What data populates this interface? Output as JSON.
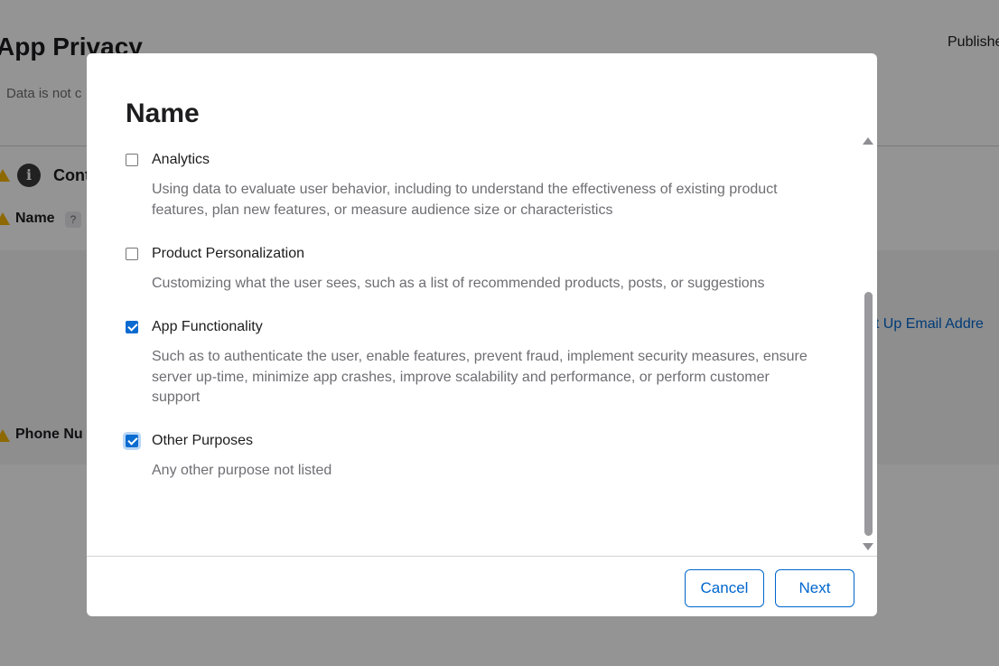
{
  "background": {
    "title": "App Privacy",
    "status_text": "Data is not c",
    "publish_text": "Publishe",
    "section_label": "Cont",
    "row_name": "Name",
    "help_glyph": "?",
    "setup_link": "et Up Email Addre",
    "row_phone": "Phone Nu"
  },
  "modal": {
    "title": "Name",
    "options": [
      {
        "label": "Analytics",
        "description": "Using data to evaluate user behavior, including to understand the effectiveness of existing product features, plan new features, or measure audience size or characteristics",
        "checked": false
      },
      {
        "label": "Product Personalization",
        "description": "Customizing what the user sees, such as a list of recommended products, posts, or suggestions",
        "checked": false
      },
      {
        "label": "App Functionality",
        "description": "Such as to authenticate the user, enable features, prevent fraud, implement security measures, ensure server up-time, minimize app crashes, improve scalability and performance, or perform customer support",
        "checked": true
      },
      {
        "label": "Other Purposes",
        "description": "Any other purpose not listed",
        "checked": true
      }
    ],
    "cancel_label": "Cancel",
    "next_label": "Next"
  },
  "colors": {
    "accent": "#0066cc",
    "checkbox_checked": "#0a6bd1",
    "warning": "#f5b400"
  }
}
